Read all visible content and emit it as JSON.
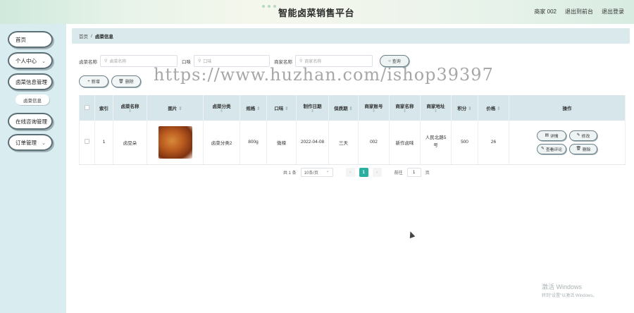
{
  "header": {
    "title": "智能卤菜销售平台",
    "user": "商家 002",
    "back_to_admin": "退出到前台",
    "logout": "退出登录"
  },
  "sidebar": {
    "items": [
      {
        "label": "首页"
      },
      {
        "label": "个人中心"
      },
      {
        "label": "卤菜信息管理"
      },
      {
        "label": "卤菜信息"
      },
      {
        "label": "在线咨询管理"
      },
      {
        "label": "订单管理"
      }
    ]
  },
  "breadcrumb": {
    "home": "首页",
    "sep": "/",
    "current": "卤菜信息"
  },
  "search": {
    "name_label": "卤菜名称",
    "name_placeholder": "卤菜名称",
    "taste_label": "口味",
    "taste_placeholder": "口味",
    "shop_label": "商家名称",
    "shop_placeholder": "商家名称",
    "query_label": "查询"
  },
  "actions": {
    "add": "新增",
    "delete": "删除"
  },
  "watermark": "https://www.huzhan.com/ishop39397",
  "table": {
    "headers": [
      "索引",
      "卤菜名称",
      "图片",
      "卤菜分类",
      "规格",
      "口味",
      "制作日期",
      "保质期",
      "商家账号",
      "商家名称",
      "商家地址",
      "积分",
      "价格",
      "操作"
    ],
    "sortable": [
      false,
      true,
      true,
      true,
      true,
      true,
      true,
      true,
      true,
      true,
      true,
      true,
      true,
      false
    ],
    "rows": [
      {
        "index": "1",
        "name": "卤豆朵",
        "category": "卤菜分类2",
        "spec": "800g",
        "taste": "微辣",
        "date": "2022-04-08",
        "shelf": "三天",
        "account": "002",
        "shop": "新作卤味",
        "address": "人民北路5号",
        "points": "500",
        "price": "26"
      }
    ],
    "ops": {
      "detail": "详情",
      "edit": "修改",
      "review": "查看评论",
      "delete": "删除"
    }
  },
  "pagination": {
    "total": "共 1 条",
    "page_size": "10条/页",
    "current_page": "1",
    "goto": "前往",
    "goto_value": "1",
    "page_suffix": "页"
  },
  "windows_watermark": {
    "line1": "激活 Windows",
    "line2": "转到\"设置\"以激活 Windows。"
  },
  "colors": {
    "accent": "#2ab0a1",
    "header_row": "#d6e6ea",
    "sidebar": "#d9edf0"
  }
}
